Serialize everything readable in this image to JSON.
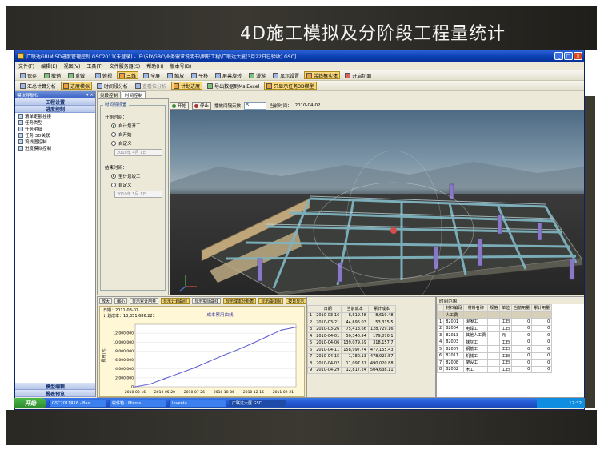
{
  "slide": {
    "title": "4D施工模拟及分阶段工程量统计"
  },
  "window": {
    "title": "广联达GBIM 5D进度管理控制 GSC2011(未登录) - [E:\\5D\\GBC\\业务需求说明书\\图形工程\\广联达大厦(3月22日已验收).GSC]",
    "buttons": [
      "_",
      "□",
      "×"
    ]
  },
  "menu": [
    "文件(F)",
    "编辑(E)",
    "视图(V)",
    "工具(T)",
    "文件服务器(S)",
    "帮助(H)",
    "版本号(B)"
  ],
  "toolbar1": [
    "保存",
    "撤销",
    "重做",
    "俯视",
    "三维",
    "全屏",
    "缩放",
    "平移",
    "屏幕旋转",
    "漫游",
    "显示设置",
    "带线框实体",
    "开启切面"
  ],
  "toolbar2": [
    "汇总计算分析",
    "进度模拟",
    "时间段分析",
    "查看位分析",
    "计划进度",
    "导出数据到Ms Excel",
    "只显示任务3D模型"
  ],
  "leftnav": {
    "header": "模块导航栏",
    "sections_top": [
      "工程设置",
      "进度控制"
    ],
    "items": [
      "清单定额挂接",
      "任务类型",
      "任务明细",
      "任务 3D关联",
      "流线图控制",
      "进度模拟控制"
    ],
    "sections_bottom": [
      "模型编辑",
      "报表预览"
    ]
  },
  "tabs": [
    "类段控制",
    "时间控制"
  ],
  "timepanel": {
    "legend": "时间段设置",
    "start_label": "开始时间：",
    "start_options": [
      "自计划开工",
      "自开始",
      "自定义"
    ],
    "start_date": "2010年 4月 1日",
    "end_label": "结束时间：",
    "end_options": [
      "至计划竣工",
      "自定义"
    ],
    "end_date": "2010年 5月 1日"
  },
  "simbar": {
    "start": "开始",
    "stop": "停止",
    "interval_label": "播放间隔天数",
    "interval_value": "5",
    "current_label": "当前时间：",
    "current_value": "2010-04-02"
  },
  "chart_toolbar": [
    "放大",
    "缩小",
    "显示累计用量",
    "显示计划曲线",
    "显示实际曲线",
    "显示成本分析表",
    "显示曲线图",
    "按日显示"
  ],
  "chart_data": {
    "type": "line",
    "title": "成本累用曲线",
    "info_lines": [
      "日期：2011-03-07",
      "计划成本：13,351,686.221"
    ],
    "ylabel": "费用(元)",
    "ylim": [
      0,
      14000000
    ],
    "yticks": [
      "12,000,000",
      "10,000,000",
      "8,000,000",
      "6,000,000",
      "4,000,000",
      "2,000,000",
      "0"
    ],
    "xticks": [
      "2010-03-16",
      "2010-05-20",
      "2010-07-26",
      "2010-10-06",
      "2010-12-16",
      "2011-02-21"
    ],
    "x": [
      "2010-03-16",
      "2010-04-15",
      "2010-05-20",
      "2010-06-20",
      "2010-07-26",
      "2010-09-01",
      "2010-10-06",
      "2010-11-10",
      "2010-12-16",
      "2011-01-20",
      "2011-02-21",
      "2011-03-07"
    ],
    "values": [
      0,
      600000,
      1800000,
      3000000,
      4200000,
      5600000,
      7000000,
      8300000,
      9700000,
      11200000,
      12700000,
      13351686
    ]
  },
  "cost_table": {
    "headers": [
      "",
      "日期",
      "当前成本",
      "累计成本"
    ],
    "rows": [
      [
        "1",
        "2010-03-16",
        "8,619.48",
        "8,619.48"
      ],
      [
        "2",
        "2010-03-21",
        "44,696.03",
        "53,315.5"
      ],
      [
        "3",
        "2010-03-26",
        "75,413.66",
        "128,729.16"
      ],
      [
        "4",
        "2010-04-01",
        "50,340.94",
        "179,070.1"
      ],
      [
        "5",
        "2010-04-06",
        "139,079.59",
        "318,157.7"
      ],
      [
        "6",
        "2010-04-11",
        "158,997.74",
        "477,155.43"
      ],
      [
        "7",
        "2010-04-15",
        "1,780.13",
        "478,923.57"
      ],
      [
        "8",
        "2010-04-02",
        "11,097.31",
        "490,020.88"
      ],
      [
        "9",
        "2010-04-29",
        "12,817.24",
        "504,638.11"
      ]
    ]
  },
  "mat_panel": {
    "header": "时间范围：",
    "headers": [
      "",
      "材料编码",
      "材料名称",
      "规格",
      "单位",
      "当前用量",
      "累计用量"
    ],
    "group_row": [
      "",
      "人工费",
      "",
      "",
      "",
      "",
      ""
    ],
    "rows": [
      [
        "1",
        "82001",
        "混凝工",
        "",
        "工日",
        "0",
        "0"
      ],
      [
        "2",
        "82004",
        "电焊工",
        "",
        "工日",
        "0",
        "0"
      ],
      [
        "3",
        "82013",
        "其他人工费",
        "",
        "元",
        "0",
        "0"
      ],
      [
        "4",
        "82003",
        "抹灰工",
        "",
        "工日",
        "0",
        "0"
      ],
      [
        "5",
        "82007",
        "钢筋工",
        "",
        "工日",
        "0",
        "0"
      ],
      [
        "6",
        "82011",
        "机械工",
        "",
        "工日",
        "0",
        "0"
      ],
      [
        "7",
        "82008",
        "架设工",
        "",
        "工日",
        "0",
        "0"
      ],
      [
        "8",
        "82002",
        "木工",
        "",
        "工日",
        "0",
        "0"
      ]
    ]
  },
  "taskbar": {
    "start": "开始",
    "tasks": [
      "GSC2011R16 - Bas...",
      "收件箱 - Micros...",
      "Inventa",
      "广联达大厦.GSC"
    ],
    "clock": "12:32"
  },
  "colors": {
    "accent": "#0a3fb0",
    "highlight": "#f8d87a",
    "chart_line": "#5a5ad0"
  }
}
